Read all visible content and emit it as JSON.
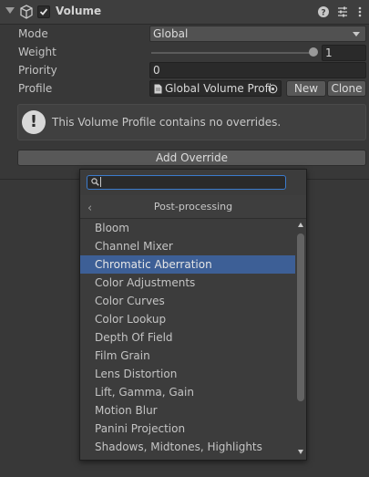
{
  "component": {
    "title": "Volume",
    "enabled": true
  },
  "fields": {
    "mode_label": "Mode",
    "mode_value": "Global",
    "weight_label": "Weight",
    "weight_value": "1",
    "weight_fraction": 1.0,
    "priority_label": "Priority",
    "priority_value": "0",
    "profile_label": "Profile",
    "profile_value": "Global Volume Profi",
    "new_button": "New",
    "clone_button": "Clone"
  },
  "help": {
    "icon": "!",
    "text": "This Volume Profile contains no overrides."
  },
  "add_override_button": "Add Override",
  "popup": {
    "search_value": "",
    "back_glyph": "‹",
    "category_title": "Post-processing",
    "selected_index": 2,
    "items": [
      {
        "label": "Bloom"
      },
      {
        "label": "Channel Mixer"
      },
      {
        "label": "Chromatic Aberration"
      },
      {
        "label": "Color Adjustments"
      },
      {
        "label": "Color Curves"
      },
      {
        "label": "Color Lookup"
      },
      {
        "label": "Depth Of Field"
      },
      {
        "label": "Film Grain"
      },
      {
        "label": "Lens Distortion"
      },
      {
        "label": "Lift, Gamma, Gain"
      },
      {
        "label": "Motion Blur"
      },
      {
        "label": "Panini Projection"
      },
      {
        "label": "Shadows, Midtones, Highlights"
      }
    ]
  },
  "colors": {
    "background": "#383838",
    "selection": "#3d5f96",
    "search_focus": "#3b7bcc"
  },
  "icons": {
    "foldout": "foldout-arrow-icon",
    "component": "cube-icon",
    "help": "help-icon",
    "presets": "presets-sliders-icon",
    "menu": "kebab-menu-icon",
    "profile": "profile-asset-icon",
    "object_picker": "object-picker-icon",
    "search": "search-icon"
  }
}
